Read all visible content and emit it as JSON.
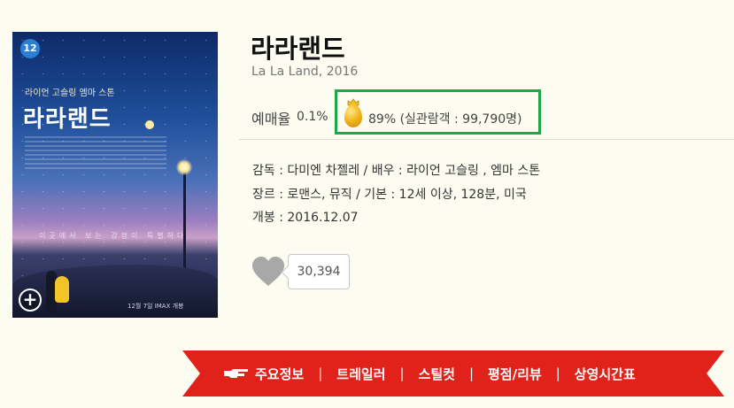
{
  "poster": {
    "age_rating": "12",
    "cast_line": "라이언 고슬링  엠마 스톤",
    "title": "라라랜드",
    "tagline": "이곳에서 보는 감정이 특별하다",
    "footer": "12월 7일 IMAX 개봉",
    "expand_icon": "plus-circle-icon"
  },
  "movie": {
    "title": "라라랜드",
    "original_title_year": "La La Land, 2016"
  },
  "booking": {
    "label": "예매율",
    "value": "0.1%"
  },
  "egg": {
    "icon": "golden-egg-icon",
    "text": "89% (실관람객 : 99,790명)",
    "highlight_color": "#1ea84a"
  },
  "details": {
    "director_cast": "감독 : 다미엔 차젤레 / 배우 : 라이언 고슬링 , 엠마 스톤",
    "genre_basic": "장르 : 로맨스, 뮤직 / 기본 : 12세 이상, 128분, 미국",
    "release": "개봉 : 2016.12.07"
  },
  "like": {
    "icon": "heart-icon",
    "count": "30,394"
  },
  "nav": {
    "hand_icon": "pointing-hand-icon",
    "ribbon_color": "#e0221b",
    "items": [
      "주요정보",
      "트레일러",
      "스틸컷",
      "평점/리뷰",
      "상영시간표"
    ],
    "separator": "|"
  }
}
